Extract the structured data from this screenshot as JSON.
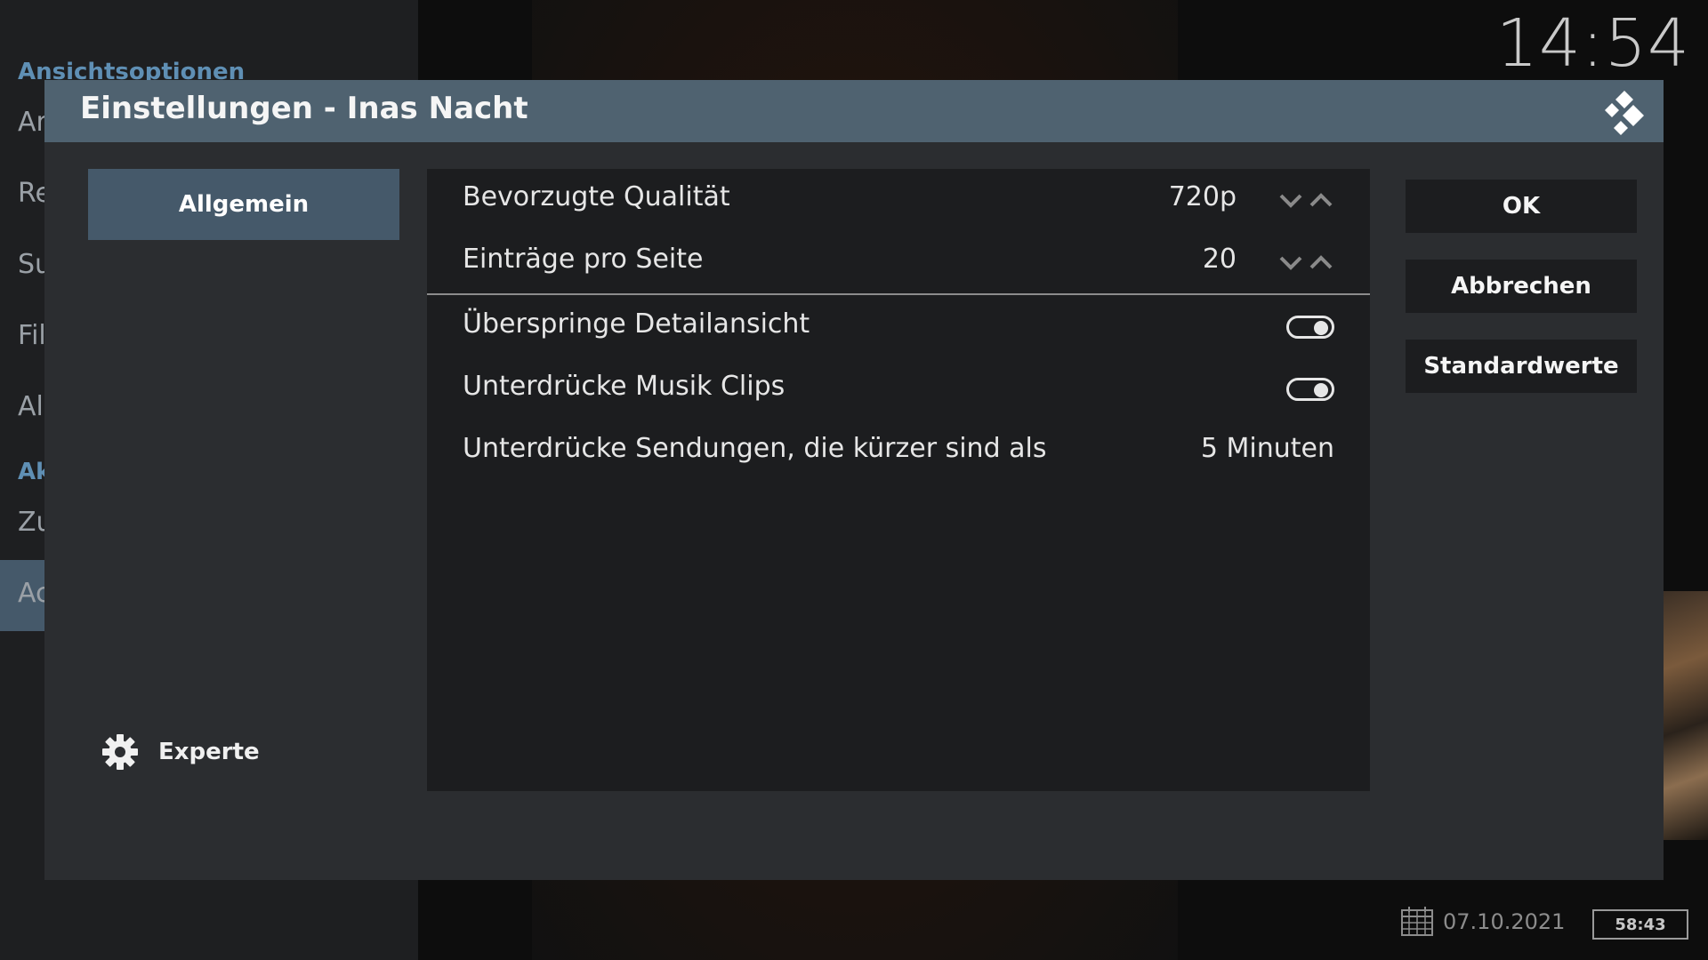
{
  "clock": "14:54",
  "background": {
    "sections": [
      {
        "label": "Ansichtsoptionen"
      },
      {
        "label": "Ak"
      }
    ],
    "items": [
      {
        "label": "An"
      },
      {
        "label": "Re"
      },
      {
        "label": "Su"
      },
      {
        "label": "Fil"
      },
      {
        "label": "All"
      },
      {
        "label": "Zu"
      },
      {
        "label": "Ac"
      }
    ]
  },
  "footer": {
    "date": "07.10.2021",
    "duration": "58:43",
    "calendar_icon": "calendar-icon"
  },
  "dialog": {
    "title": "Einstellungen - Inas Nacht",
    "logo_icon": "kodi-logo-icon",
    "category": "Allgemein",
    "level_label": "Experte",
    "level_icon": "gear-icon",
    "settings": [
      {
        "label": "Bevorzugte Qualität",
        "value": "720p",
        "control": "spinner"
      },
      {
        "label": "Einträge pro Seite",
        "value": "20",
        "control": "spinner"
      },
      {
        "label": "Überspringe Detailansicht",
        "value": "on",
        "control": "toggle"
      },
      {
        "label": "Unterdrücke Musik Clips",
        "value": "on",
        "control": "toggle"
      },
      {
        "label": "Unterdrücke Sendungen, die kürzer sind als",
        "value": "5 Minuten",
        "control": "value"
      }
    ],
    "buttons": {
      "ok": "OK",
      "cancel": "Abbrechen",
      "defaults": "Standardwerte"
    }
  },
  "colors": {
    "header": "#4f6270",
    "selected": "#45596a",
    "panel": "#1c1d1f",
    "dialog": "#2b2d30"
  }
}
